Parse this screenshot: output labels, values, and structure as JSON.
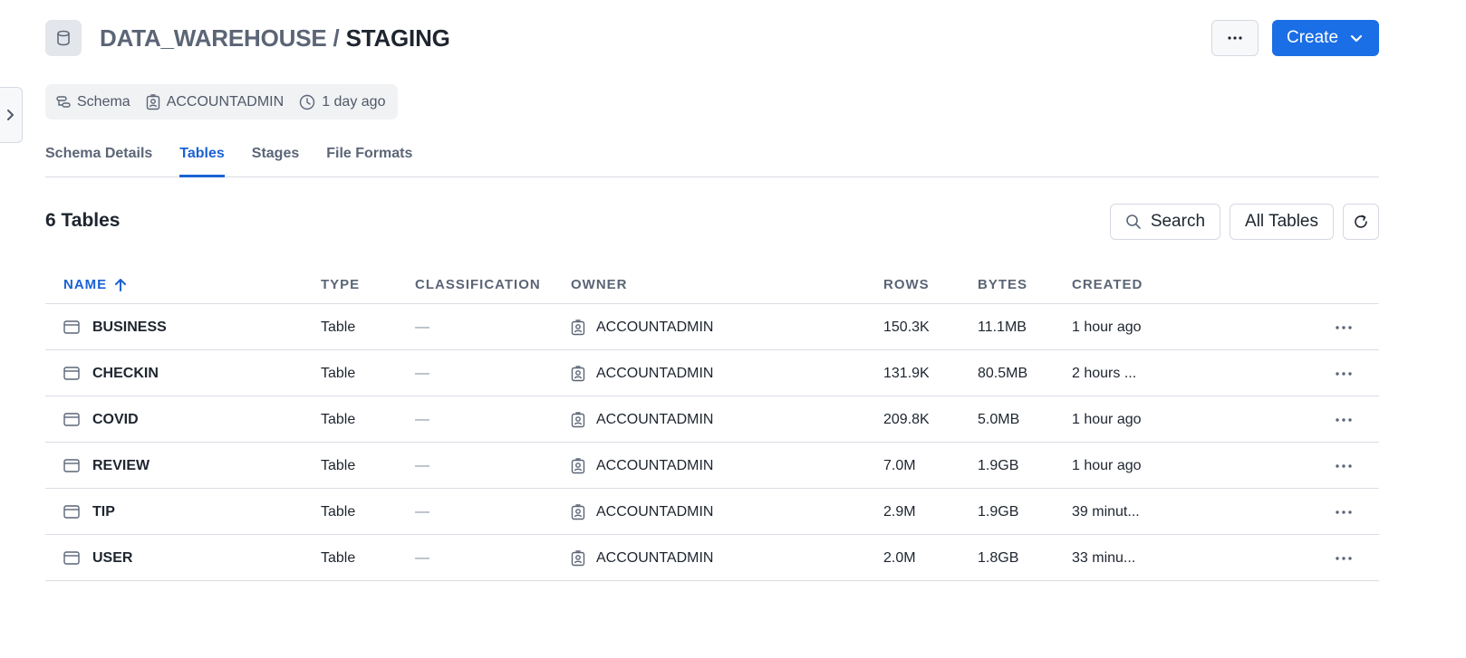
{
  "header": {
    "db_icon": "database-icon",
    "breadcrumb_parent": "DATA_WAREHOUSE",
    "separator": " / ",
    "current": "STAGING",
    "more_icon": "ellipsis-icon",
    "create_label": "Create",
    "create_icon": "chevron-down-icon"
  },
  "meta": {
    "type_label": "Schema",
    "owner": "ACCOUNTADMIN",
    "age": "1 day ago"
  },
  "tabs": [
    {
      "label": "Schema Details",
      "active": false
    },
    {
      "label": "Tables",
      "active": true
    },
    {
      "label": "Stages",
      "active": false
    },
    {
      "label": "File Formats",
      "active": false
    }
  ],
  "section": {
    "title": "6 Tables",
    "search_label": "Search",
    "filter_label": "All Tables"
  },
  "table": {
    "columns": {
      "name": "NAME",
      "type": "TYPE",
      "classification": "CLASSIFICATION",
      "owner": "OWNER",
      "rows": "ROWS",
      "bytes": "BYTES",
      "created": "CREATED"
    },
    "sort": {
      "column": "name",
      "direction": "ascending"
    },
    "rows": [
      {
        "name": "BUSINESS",
        "type": "Table",
        "classification": "—",
        "owner": "ACCOUNTADMIN",
        "rows": "150.3K",
        "bytes": "11.1MB",
        "created": "1 hour ago"
      },
      {
        "name": "CHECKIN",
        "type": "Table",
        "classification": "—",
        "owner": "ACCOUNTADMIN",
        "rows": "131.9K",
        "bytes": "80.5MB",
        "created": "2 hours ..."
      },
      {
        "name": "COVID",
        "type": "Table",
        "classification": "—",
        "owner": "ACCOUNTADMIN",
        "rows": "209.8K",
        "bytes": "5.0MB",
        "created": "1 hour ago"
      },
      {
        "name": "REVIEW",
        "type": "Table",
        "classification": "—",
        "owner": "ACCOUNTADMIN",
        "rows": "7.0M",
        "bytes": "1.9GB",
        "created": "1 hour ago"
      },
      {
        "name": "TIP",
        "type": "Table",
        "classification": "—",
        "owner": "ACCOUNTADMIN",
        "rows": "2.9M",
        "bytes": "1.9GB",
        "created": "39 minut..."
      },
      {
        "name": "USER",
        "type": "Table",
        "classification": "—",
        "owner": "ACCOUNTADMIN",
        "rows": "2.0M",
        "bytes": "1.8GB",
        "created": "33 minu..."
      }
    ]
  },
  "colors": {
    "accent": "#1a6ee6",
    "active_tab": "#1a62d4",
    "muted_text": "#5b6576"
  }
}
